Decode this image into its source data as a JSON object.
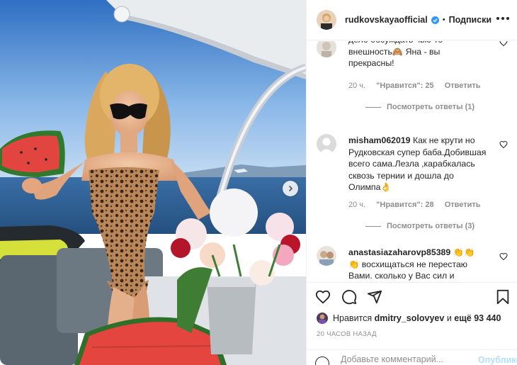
{
  "post": {
    "username": "rudkovskayaofficial",
    "dot": "•",
    "follow_label": "Подписки",
    "photo_alt": "photo",
    "carousel_next_icon": "chevron-right-icon"
  },
  "comments": [
    {
      "username": "",
      "text": "дело обсуждать чью-то внешность🙈 Яна - вы прекрасны!",
      "time": "20 ч.",
      "likes": "\"Нравится\": 25",
      "reply": "Ответить",
      "view_replies": "Посмотреть ответы (1)"
    },
    {
      "username": "misham062019",
      "text": "Как не крути но Рудковская супер баба.Добившая всего сама.Лезла ,карабкалась сквозь тернии и дошла до Олимпа👌",
      "time": "20 ч.",
      "likes": "\"Нравится\": 28",
      "reply": "Ответить",
      "view_replies": "Посмотреть ответы (3)"
    },
    {
      "username": "anastasiazaharovp85389",
      "text": "👏👏 👏 восхищаться не перестаю Вами. сколько у Вас сил и",
      "time": "",
      "likes": "",
      "reply": "",
      "view_replies": ""
    }
  ],
  "likes_row": {
    "prefix": "Нравится",
    "user": "dmitry_solovyev",
    "and": "и",
    "others": "ещё 93 440"
  },
  "time_ago": "20 ЧАСОВ НАЗАД",
  "add_comment": {
    "placeholder": "Добавьте комментарий...",
    "publish_label": "Опубликовать"
  },
  "colors": {
    "verified": "#3897f0",
    "text": "#262626",
    "muted": "#8e8e8e",
    "publish_disabled": "#b2dffc"
  }
}
